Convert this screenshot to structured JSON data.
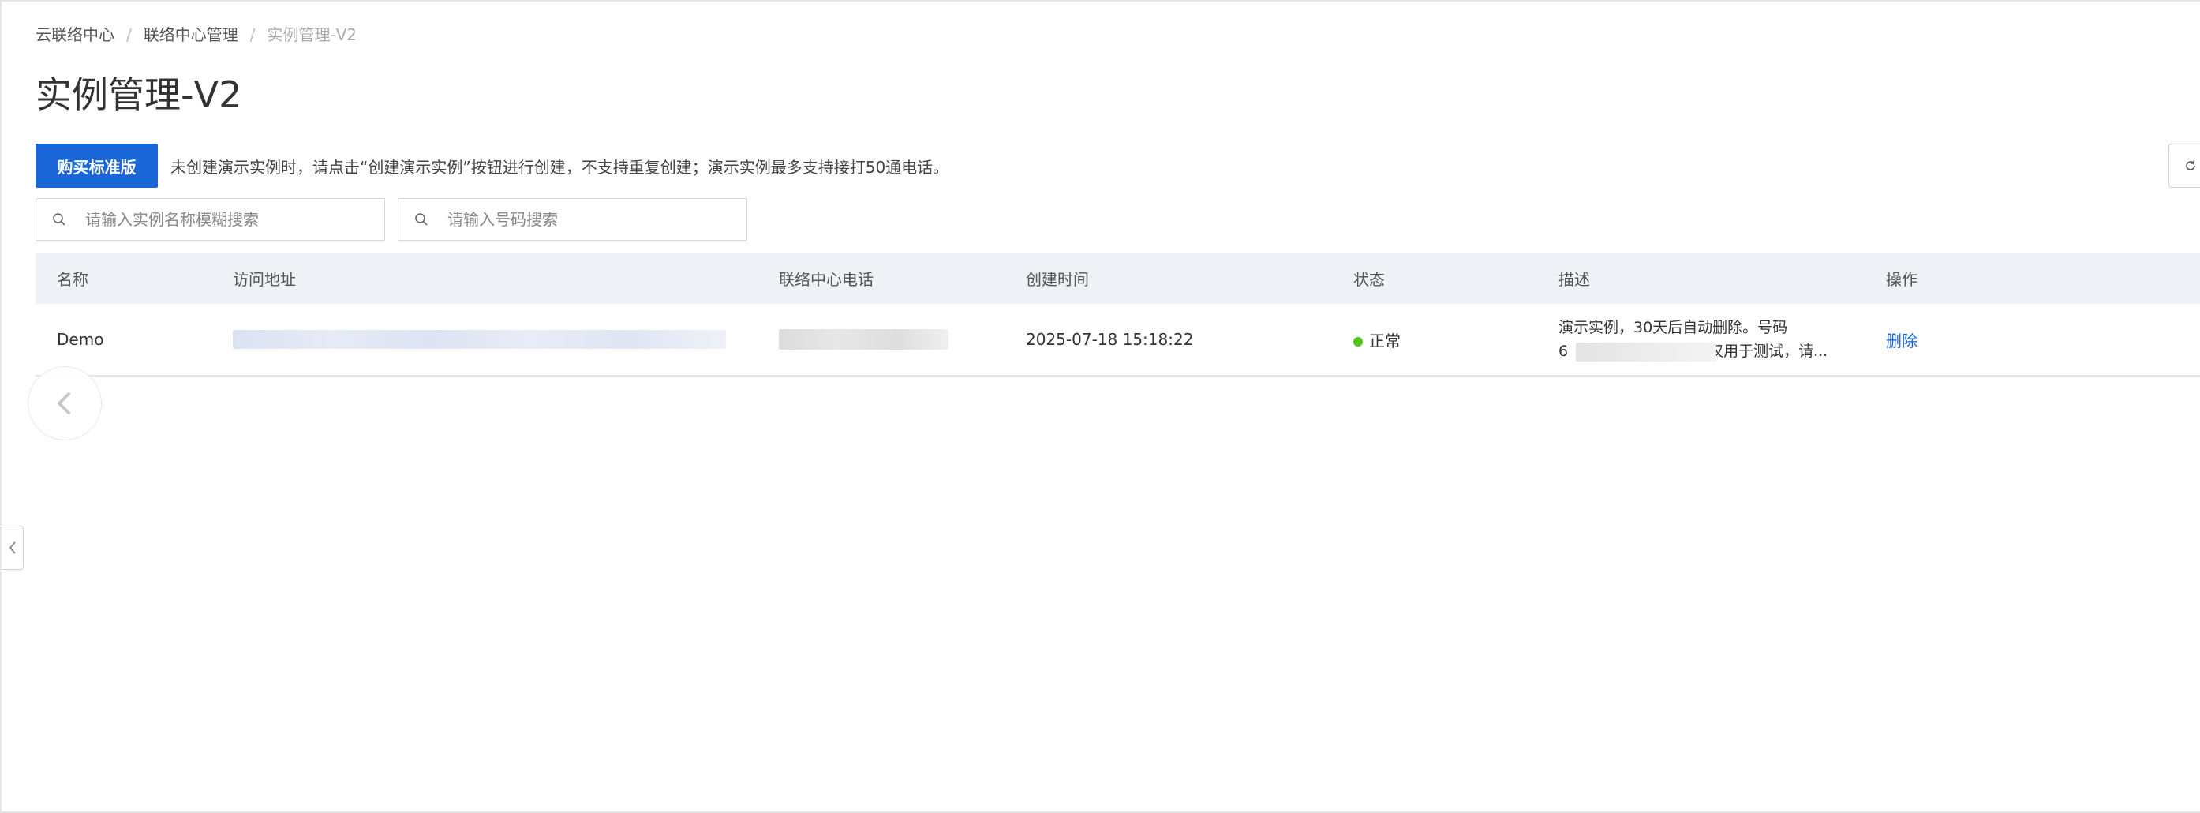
{
  "breadcrumb": {
    "items": [
      "云联络中心",
      "联络中心管理"
    ],
    "current": "实例管理-V2",
    "separator": "/"
  },
  "page": {
    "title": "实例管理-V2"
  },
  "toolbar": {
    "buy_label": "购买标准版",
    "tip": "未创建演示实例时，请点击“创建演示实例”按钮进行创建，不支持重复创建；演示实例最多支持接打50通电话。"
  },
  "search": {
    "name_placeholder": "请输入实例名称模糊搜索",
    "number_placeholder": "请输入号码搜索"
  },
  "table": {
    "columns": [
      "名称",
      "访问地址",
      "联络中心电话",
      "创建时间",
      "状态",
      "描述",
      "操作"
    ],
    "rows": [
      {
        "name": "Demo",
        "created_at": "2025-07-18 15:18:22",
        "status": "正常",
        "desc_line1": "演示实例，30天后自动删除。号码",
        "desc_line2_prefix": "6",
        "desc_line2_suffix": "仅用于测试，请...",
        "op": "删除"
      }
    ]
  },
  "colors": {
    "primary": "#1b66d6",
    "status_ok": "#52c41a",
    "header_bg": "#eef1f6"
  },
  "icons": [
    "search-icon",
    "refresh-icon",
    "chevron-left-icon"
  ]
}
